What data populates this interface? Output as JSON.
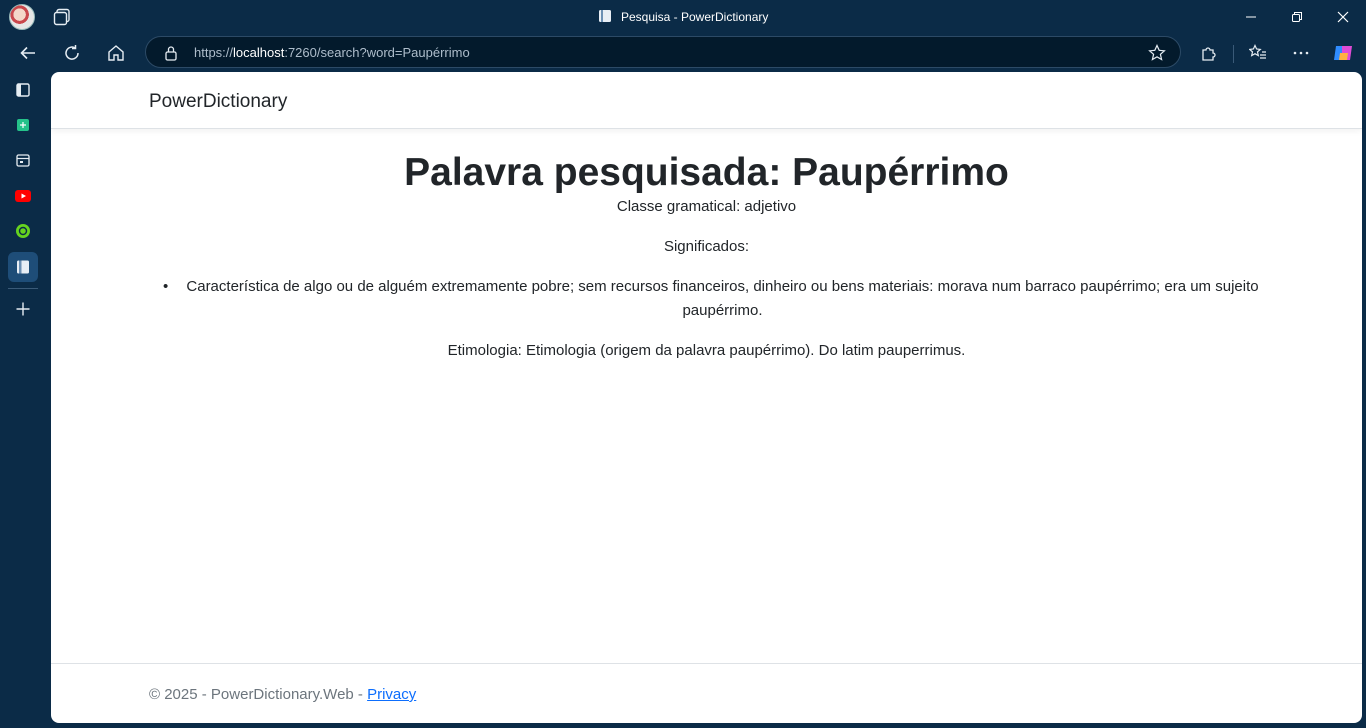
{
  "browser": {
    "window_title": "Pesquisa - PowerDictionary",
    "url_prefix": "https://",
    "url_host": "localhost",
    "url_rest": ":7260/search?word=Paupérrimo"
  },
  "colors": {
    "browser_chrome": "#0b2b47",
    "link": "#0d6efd",
    "text": "#212529",
    "muted": "#6c757d"
  },
  "page": {
    "brand": "PowerDictionary",
    "heading": "Palavra pesquisada: Paupérrimo",
    "classe": "Classe gramatical: adjetivo",
    "significados_label": "Significados:",
    "significados": [
      "Característica de algo ou de alguém extremamente pobre; sem recursos financeiros, dinheiro ou bens materiais: morava num barraco paupérrimo; era um sujeito paupérrimo."
    ],
    "etimologia": "Etimologia: Etimologia (origem da palavra paupérrimo). Do latim pauperrimus."
  },
  "footer": {
    "copyright": "© 2025 - PowerDictionary.Web - ",
    "privacy_link": "Privacy"
  }
}
